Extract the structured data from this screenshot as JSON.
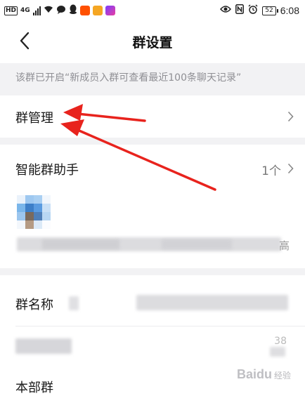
{
  "status_bar": {
    "time": "6:08",
    "battery": "52",
    "network_badge": "HD",
    "network_type": "4G"
  },
  "nav": {
    "title": "群设置"
  },
  "notice": {
    "text": "该群已开启“新成员入群可查看最近100条聊天记录”"
  },
  "rows": {
    "group_manage": {
      "label": "群管理"
    },
    "smart_assistant": {
      "label": "智能群助手",
      "value": "1个"
    },
    "group_name": {
      "label": "群名称"
    },
    "right_partial_char": "高",
    "partial_count": "38",
    "bottom_partial_label": "本部群"
  },
  "watermark": {
    "logo": "Baidu",
    "sub": "经验"
  },
  "colors": {
    "arrow_red": "#e8231d",
    "separator_bg": "#f2f2f4",
    "notice_text": "#8f8f94"
  },
  "icons": [
    "back-arrow-icon",
    "chevron-right-icon",
    "eye-icon",
    "nfc-icon",
    "alarm-icon",
    "wifi-icon",
    "chat-icon",
    "qq-icon"
  ]
}
